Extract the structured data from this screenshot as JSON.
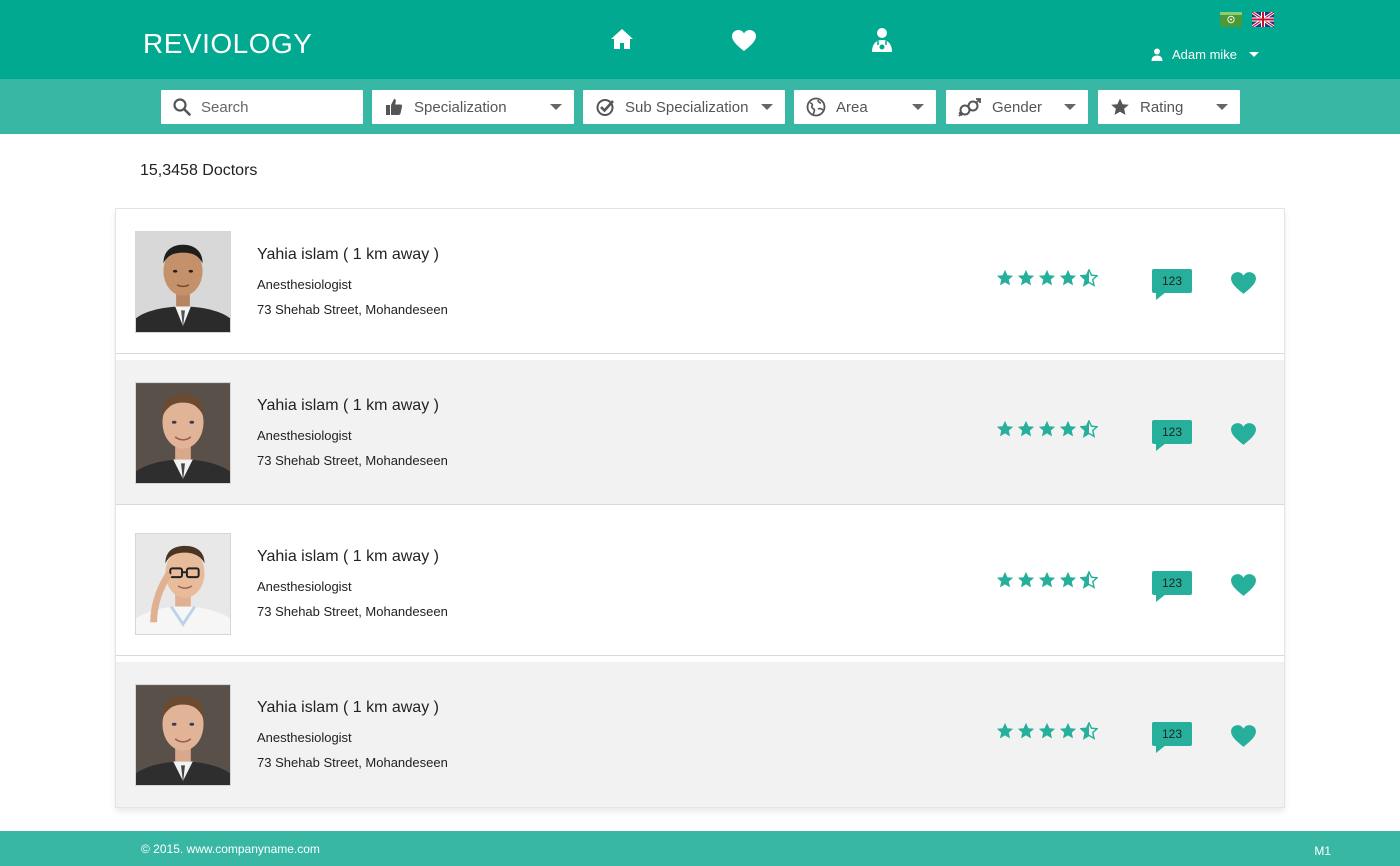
{
  "header": {
    "logo": "REVIOLOGY",
    "nav_icons": [
      "home-icon",
      "heart-icon",
      "doctor-icon"
    ],
    "languages": [
      "arabic",
      "english"
    ],
    "user_name": "Adam mike"
  },
  "filters": {
    "search_placeholder": "Search",
    "items": [
      {
        "label": "Specialization",
        "icon": "thumbs-up-icon"
      },
      {
        "label": "Sub Specialization",
        "icon": "check-circle-icon"
      },
      {
        "label": "Area",
        "icon": "globe-icon"
      },
      {
        "label": "Gender",
        "icon": "gender-icon"
      },
      {
        "label": "Rating",
        "icon": "star-icon"
      }
    ]
  },
  "results": {
    "count_label": "15,3458 Doctors"
  },
  "doctors": [
    {
      "name": "Yahia islam  ( 1 km away )",
      "specialty": "Anesthesiologist",
      "address": "73 Shehab Street, Mohandeseen",
      "rating": 4.5,
      "reviews": "123"
    },
    {
      "name": "Yahia islam  ( 1 km away )",
      "specialty": "Anesthesiologist",
      "address": "73 Shehab Street, Mohandeseen",
      "rating": 4.5,
      "reviews": "123"
    },
    {
      "name": "Yahia islam  ( 1 km away )",
      "specialty": "Anesthesiologist",
      "address": "73 Shehab Street, Mohandeseen",
      "rating": 4.5,
      "reviews": "123"
    },
    {
      "name": "Yahia islam  ( 1 km away )",
      "specialty": "Anesthesiologist",
      "address": "73 Shehab Street, Mohandeseen",
      "rating": 4.5,
      "reviews": "123"
    }
  ],
  "footer": {
    "copyright": "© 2015. www.companyname.com",
    "page_code": "M1"
  },
  "colors": {
    "primary": "#00a98f",
    "secondary": "#38b8a4",
    "accent": "#26b09b"
  }
}
